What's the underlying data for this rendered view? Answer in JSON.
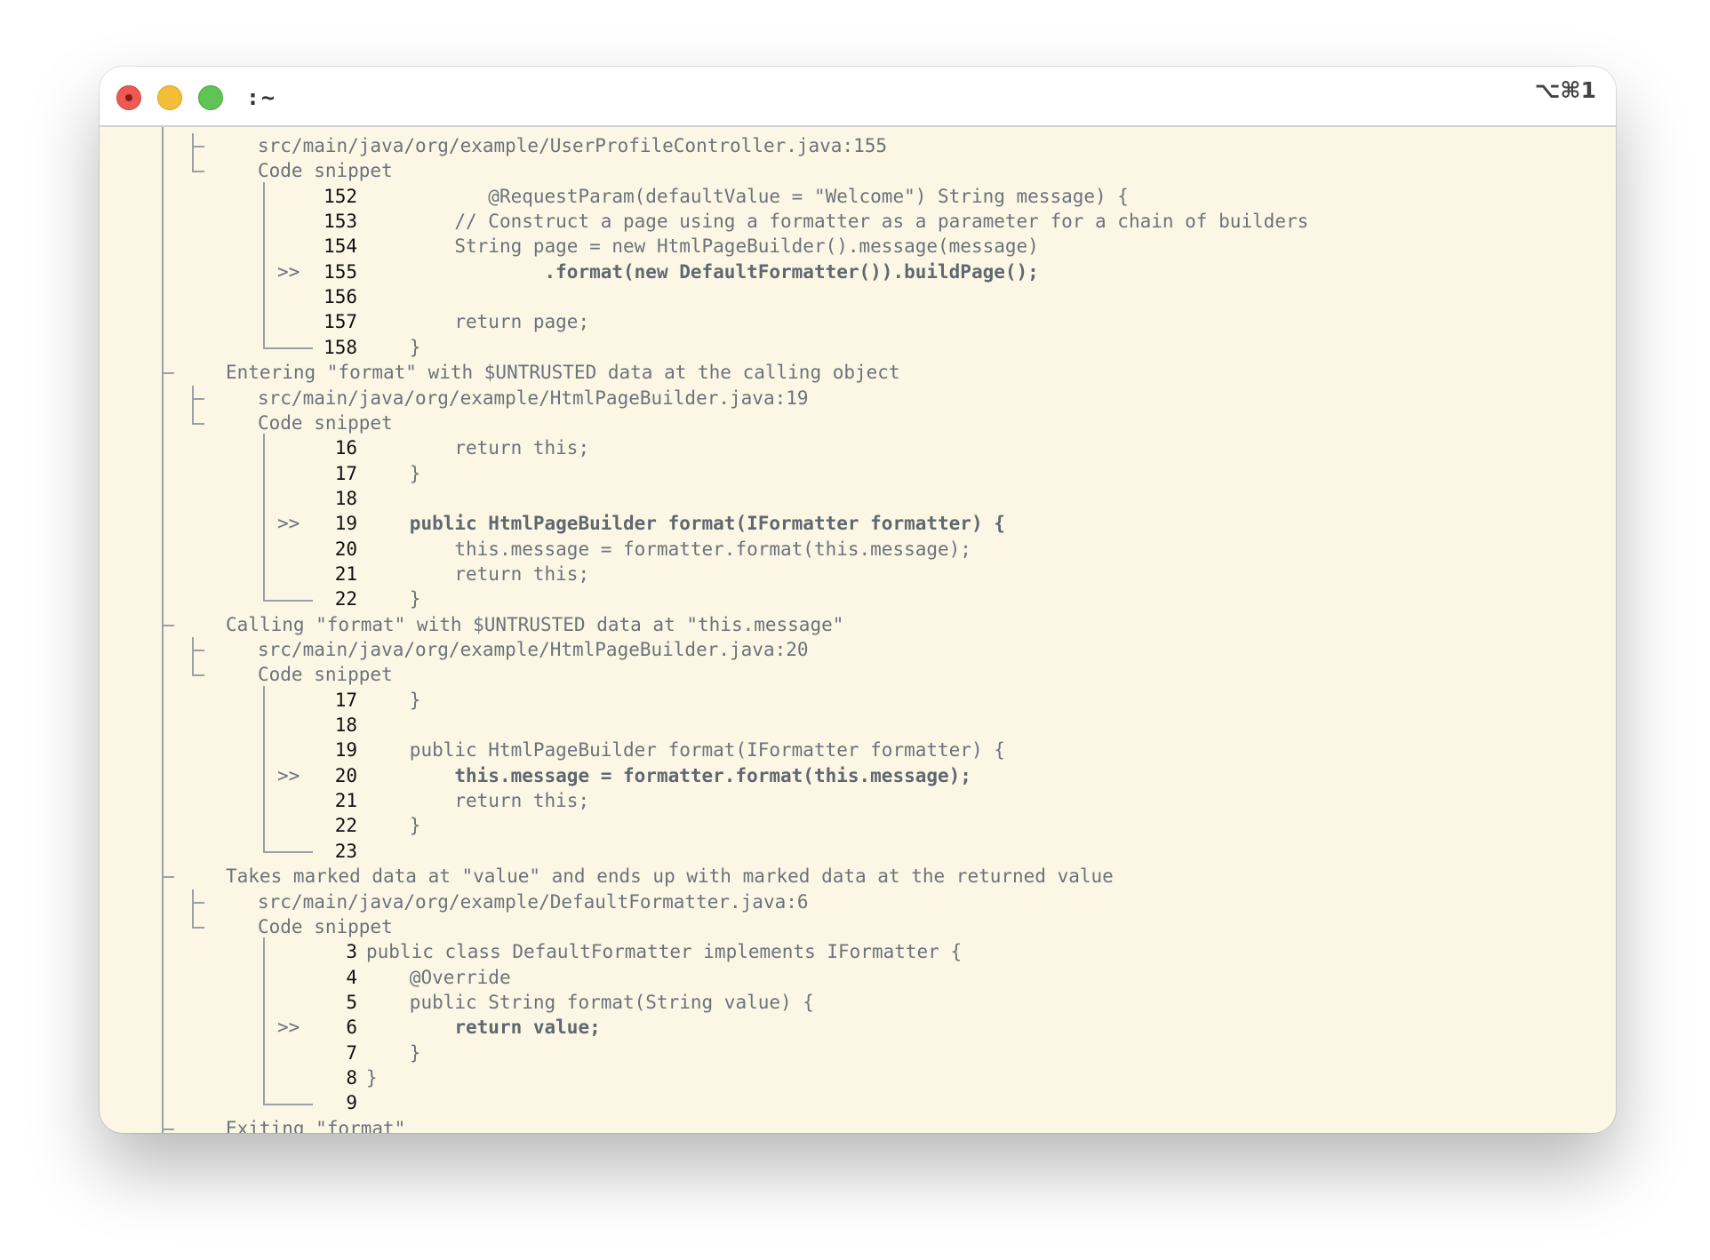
{
  "window": {
    "title": ":~",
    "shortcut": "⌥⌘1"
  },
  "trace": [
    {
      "kind": "file",
      "text": "src/main/java/org/example/UserProfileController.java:155"
    },
    {
      "kind": "snippet",
      "text": "Code snippet"
    },
    {
      "kind": "code",
      "num": "152",
      "text": "       @RequestParam(defaultValue = \"Welcome\") String message) {"
    },
    {
      "kind": "code",
      "num": "153",
      "text": "    // Construct a page using a formatter as a parameter for a chain of builders"
    },
    {
      "kind": "code",
      "num": "154",
      "text": "    String page = new HtmlPageBuilder().message(message)"
    },
    {
      "kind": "code",
      "num": "155",
      "mark": ">>",
      "bold": true,
      "text": "            .format(new DefaultFormatter()).buildPage();"
    },
    {
      "kind": "code",
      "num": "156",
      "text": ""
    },
    {
      "kind": "code",
      "num": "157",
      "text": "    return page;"
    },
    {
      "kind": "code",
      "num": "158",
      "text": "}"
    },
    {
      "kind": "step",
      "text": "Entering \"format\" with $UNTRUSTED data at the calling object"
    },
    {
      "kind": "file",
      "text": "src/main/java/org/example/HtmlPageBuilder.java:19"
    },
    {
      "kind": "snippet",
      "text": "Code snippet"
    },
    {
      "kind": "code",
      "num": "16",
      "text": "    return this;"
    },
    {
      "kind": "code",
      "num": "17",
      "text": "}"
    },
    {
      "kind": "code",
      "num": "18",
      "text": ""
    },
    {
      "kind": "code",
      "num": "19",
      "mark": ">>",
      "bold": true,
      "text": "public HtmlPageBuilder format(IFormatter formatter) {"
    },
    {
      "kind": "code",
      "num": "20",
      "text": "    this.message = formatter.format(this.message);"
    },
    {
      "kind": "code",
      "num": "21",
      "text": "    return this;"
    },
    {
      "kind": "code",
      "num": "22",
      "text": "}"
    },
    {
      "kind": "step",
      "text": "Calling \"format\" with $UNTRUSTED data at \"this.message\""
    },
    {
      "kind": "file",
      "text": "src/main/java/org/example/HtmlPageBuilder.java:20"
    },
    {
      "kind": "snippet",
      "text": "Code snippet"
    },
    {
      "kind": "code",
      "num": "17",
      "text": "}"
    },
    {
      "kind": "code",
      "num": "18",
      "text": ""
    },
    {
      "kind": "code",
      "num": "19",
      "text": "public HtmlPageBuilder format(IFormatter formatter) {"
    },
    {
      "kind": "code",
      "num": "20",
      "mark": ">>",
      "bold": true,
      "text": "    this.message = formatter.format(this.message);"
    },
    {
      "kind": "code",
      "num": "21",
      "text": "    return this;"
    },
    {
      "kind": "code",
      "num": "22",
      "text": "}"
    },
    {
      "kind": "code",
      "num": "23",
      "text": ""
    },
    {
      "kind": "step",
      "text": "Takes marked data at \"value\" and ends up with marked data at the returned value"
    },
    {
      "kind": "file",
      "text": "src/main/java/org/example/DefaultFormatter.java:6"
    },
    {
      "kind": "snippet",
      "text": "Code snippet"
    },
    {
      "kind": "code",
      "num": "3",
      "indent": 0,
      "text": "public class DefaultFormatter implements IFormatter {"
    },
    {
      "kind": "code",
      "num": "4",
      "text": "@Override"
    },
    {
      "kind": "code",
      "num": "5",
      "text": "public String format(String value) {"
    },
    {
      "kind": "code",
      "num": "6",
      "mark": ">>",
      "bold": true,
      "text": "    return value;"
    },
    {
      "kind": "code",
      "num": "7",
      "text": "}"
    },
    {
      "kind": "code",
      "num": "8",
      "indent": 0,
      "text": "}"
    },
    {
      "kind": "code",
      "num": "9",
      "text": ""
    },
    {
      "kind": "step",
      "text": "Exiting \"format\""
    }
  ]
}
